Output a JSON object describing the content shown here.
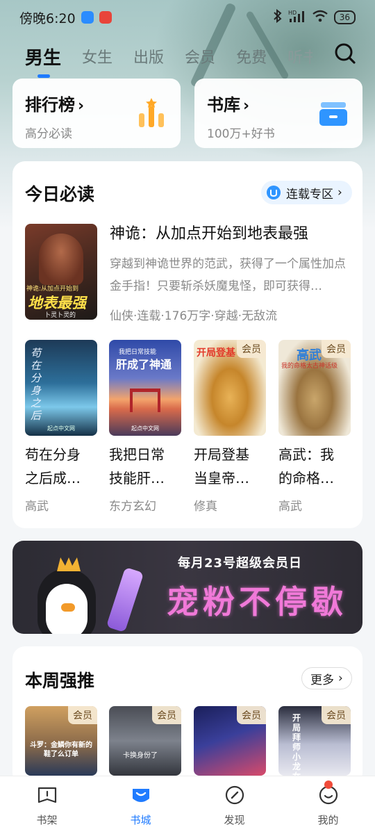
{
  "status_bar": {
    "time": "傍晚6:20",
    "battery": "36",
    "network": "HD"
  },
  "tabs": [
    {
      "label": "男生",
      "active": true
    },
    {
      "label": "女生"
    },
    {
      "label": "出版"
    },
    {
      "label": "会员"
    },
    {
      "label": "免费"
    },
    {
      "label": "听书"
    }
  ],
  "quick_cards": [
    {
      "title": "排行榜",
      "arrow": "›",
      "subtitle": "高分必读",
      "icon": "ranking-bars-icon"
    },
    {
      "title": "书库",
      "arrow": "›",
      "subtitle": "100万+好书",
      "icon": "book-stack-icon"
    }
  ],
  "today_section": {
    "title": "今日必读",
    "pill_label": "连载专区",
    "pill_icon": "serial-icon",
    "featured": {
      "title": "神诡：从加点开始到地表最强",
      "desc": "穿越到神诡世界的范武，获得了一个属性加点金手指！只要斩杀妖魔鬼怪，即可获得…",
      "meta": "仙侠·连载·176万字·穿越·无敌流",
      "cover_text": "地表最强",
      "cover_top": "神诡:从加点开始到",
      "cover_author": "卜灵卜灵的"
    },
    "books": [
      {
        "title_line1": "苟在分身",
        "title_line2": "之后成…",
        "tag": "高武",
        "vip": false,
        "cover_text": "苟在分身之后"
      },
      {
        "title_line1": "我把日常",
        "title_line2": "技能肝…",
        "tag": "东方玄幻",
        "vip": false,
        "cover_text": "肝成了神通",
        "cover_top": "我把日常技能"
      },
      {
        "title_line1": "开局登基",
        "title_line2": "当皇帝…",
        "tag": "修真",
        "vip": true,
        "cover_text": "开局登基"
      },
      {
        "title_line1": "高武：我",
        "title_line2": "的命格…",
        "tag": "高武",
        "vip": true,
        "cover_text": "高武",
        "cover_top": "我的命格太古神话级"
      }
    ],
    "vip_label": "会员",
    "publisher_mark": "起点中文网"
  },
  "banner": {
    "subtitle": "每月23号超级会员日",
    "title": "宠粉不停歇"
  },
  "weekly_section": {
    "title": "本周强推",
    "more_label": "更多",
    "books": [
      {
        "vip": true,
        "cover_text": "斗罗：金鳞你有新的鞋了么订单"
      },
      {
        "vip": true,
        "cover_text": "卡换身份了"
      },
      {
        "vip": true,
        "cover_text": ""
      },
      {
        "vip": true,
        "cover_text": "开局拜师小龙女"
      }
    ]
  },
  "bottom_nav": [
    {
      "label": "书架",
      "icon": "bookshelf-icon"
    },
    {
      "label": "书城",
      "icon": "bookstore-icon",
      "active": true
    },
    {
      "label": "发现",
      "icon": "discover-compass-icon"
    },
    {
      "label": "我的",
      "icon": "profile-smile-icon",
      "badge": true
    }
  ],
  "colors": {
    "accent": "#1f7bff",
    "vip_badge_bg": "#f5e9d2",
    "ranking_icon": "#ffad33",
    "library_icon": "#3a9bff"
  }
}
